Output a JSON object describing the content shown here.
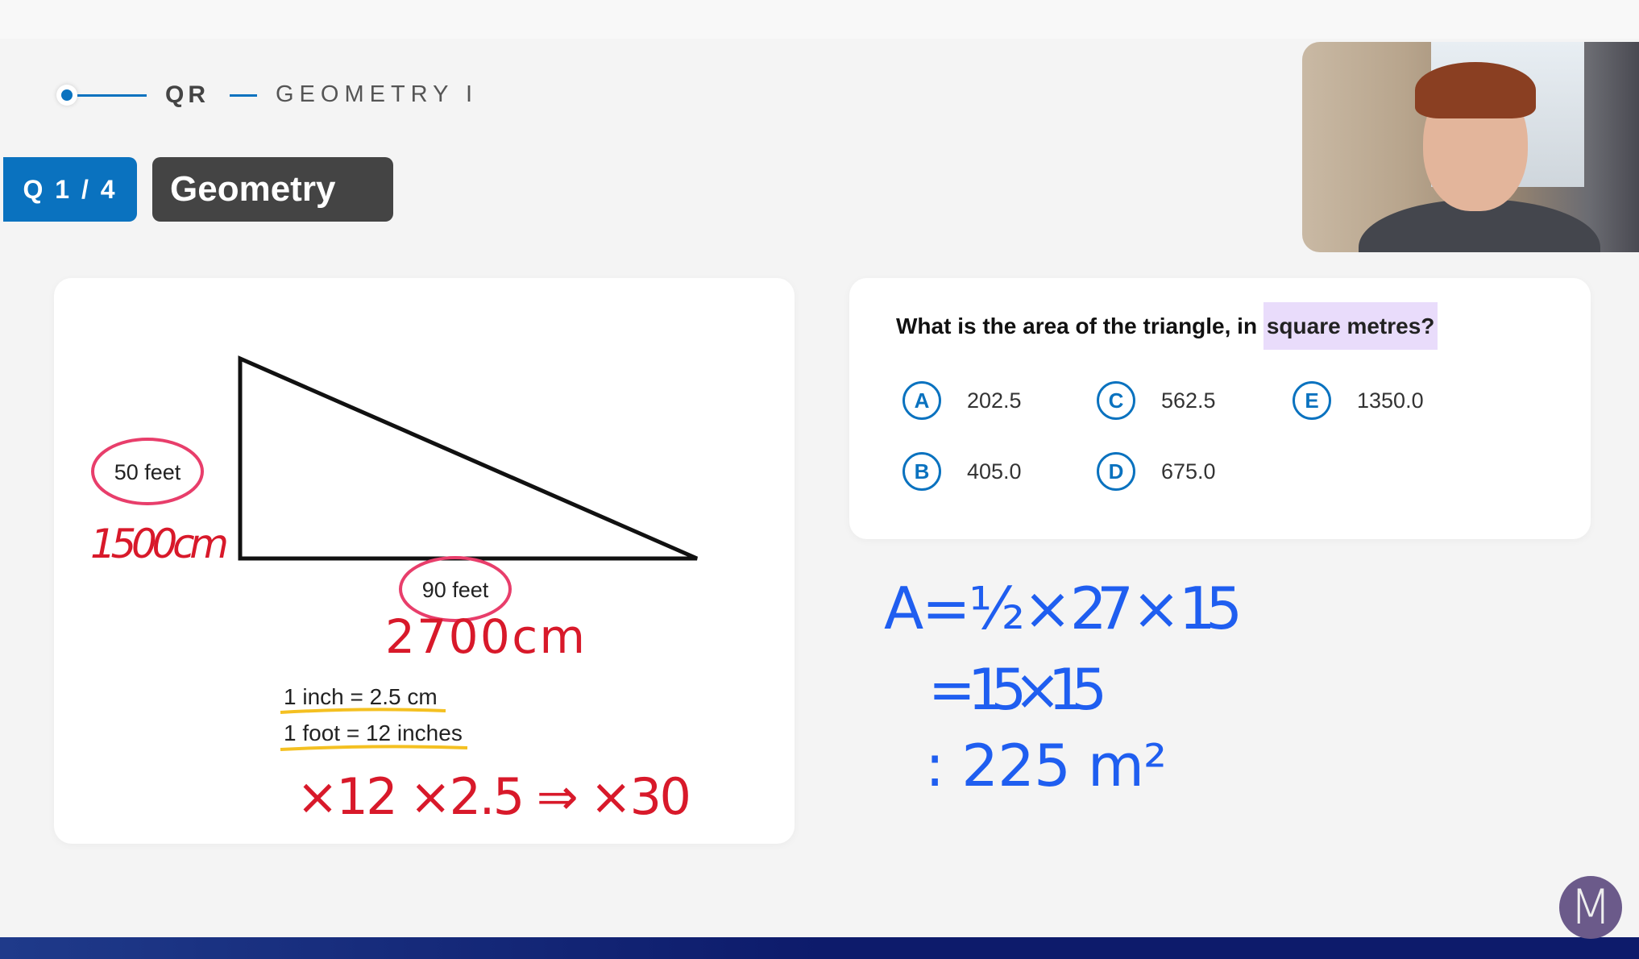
{
  "header": {
    "breadcrumb": [
      "QR",
      "GEOMETRY I"
    ],
    "question_counter": "Q 1 / 4",
    "topic": "Geometry"
  },
  "figure": {
    "left_label": "50 feet",
    "bottom_label": "90 feet",
    "conversions": [
      "1 inch = 2.5 cm",
      "1 foot = 12 inches"
    ]
  },
  "annotations_red": {
    "left_cm": "1500cm",
    "bottom_cm": "2700cm",
    "factor": "×12 ×2.5 ⇒ ×30"
  },
  "question": {
    "text_before": "What is the area of the triangle, in ",
    "text_highlight": "square metres?",
    "options": [
      {
        "letter": "A",
        "value": "202.5"
      },
      {
        "letter": "B",
        "value": "405.0"
      },
      {
        "letter": "C",
        "value": "562.5"
      },
      {
        "letter": "D",
        "value": "675.0"
      },
      {
        "letter": "E",
        "value": "1350.0"
      }
    ]
  },
  "annotations_blue": {
    "line1": "A = ½ × 27 × 15",
    "line2": "= 15×15",
    "line3": ": 225 m²"
  },
  "logo": {
    "letter": "M"
  },
  "colors": {
    "accent": "#0a72bf",
    "topic_badge": "#444444",
    "highlight": "#e9dcfb",
    "red_ink": "#d8192a",
    "blue_ink": "#1f5ef0",
    "circle_pink": "#e83e6b",
    "underline_yellow": "#f4c021",
    "bottom_bar": "#0d1b6b"
  }
}
